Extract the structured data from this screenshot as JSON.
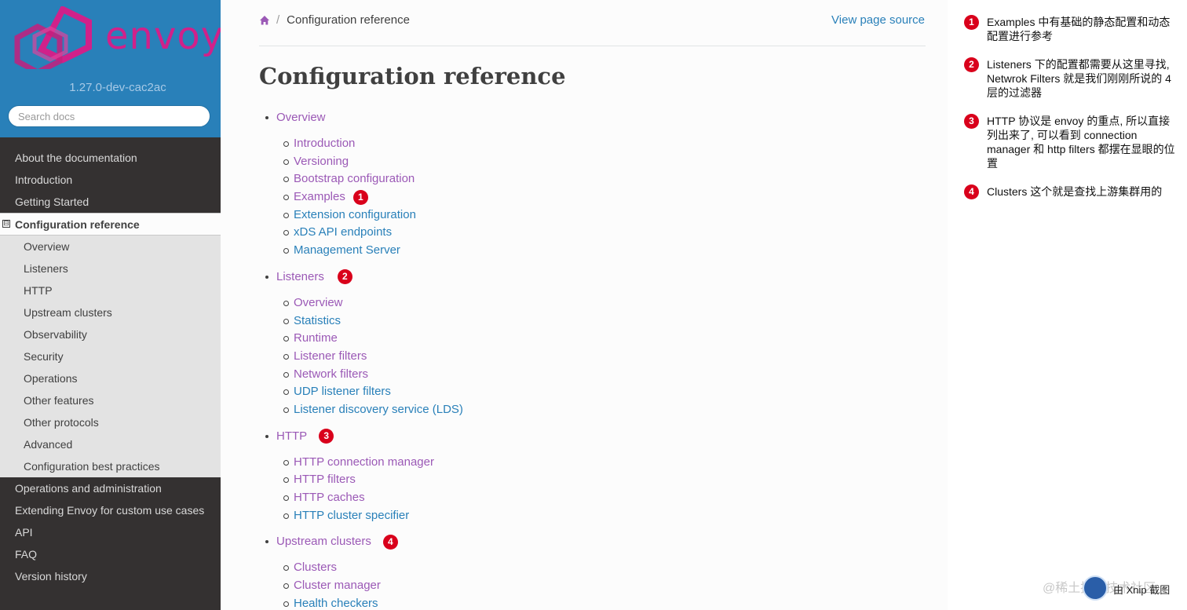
{
  "sidebar": {
    "logo_text": "envoy",
    "version": "1.27.0-dev-cac2ac",
    "search_placeholder": "Search docs",
    "items_top": [
      "About the documentation",
      "Introduction",
      "Getting Started"
    ],
    "current": {
      "toggle": "⊟",
      "label": "Configuration reference"
    },
    "sub_items": [
      "Overview",
      "Listeners",
      "HTTP",
      "Upstream clusters",
      "Observability",
      "Security",
      "Operations",
      "Other features",
      "Other protocols",
      "Advanced",
      "Configuration best practices"
    ],
    "items_bottom": [
      "Operations and administration",
      "Extending Envoy for custom use cases",
      "API",
      "FAQ",
      "Version history"
    ]
  },
  "colors": {
    "sidebar_bg": "#343131",
    "brand_bg": "#2980b9",
    "link": "#2980b9",
    "visited": "#9b59b6",
    "badge": "#d9001b"
  },
  "breadcrumb": {
    "home_icon": "home-icon",
    "separator": "/",
    "current": "Configuration reference"
  },
  "view_source": "View page source",
  "page_title": "Configuration reference",
  "toc": [
    {
      "label": "Overview",
      "badge": "",
      "links": [
        {
          "label": "Introduction",
          "visited": true
        },
        {
          "label": "Versioning",
          "visited": true
        },
        {
          "label": "Bootstrap configuration",
          "visited": true
        },
        {
          "label": "Examples",
          "visited": true,
          "badge": "1"
        },
        {
          "label": "Extension configuration",
          "visited": false
        },
        {
          "label": "xDS API endpoints",
          "visited": false
        },
        {
          "label": "Management Server",
          "visited": false
        }
      ]
    },
    {
      "label": "Listeners",
      "badge": "2",
      "links": [
        {
          "label": "Overview",
          "visited": true
        },
        {
          "label": "Statistics",
          "visited": false
        },
        {
          "label": "Runtime",
          "visited": true
        },
        {
          "label": "Listener filters",
          "visited": true
        },
        {
          "label": "Network filters",
          "visited": true
        },
        {
          "label": "UDP listener filters",
          "visited": false
        },
        {
          "label": "Listener discovery service (LDS)",
          "visited": false
        }
      ]
    },
    {
      "label": "HTTP",
      "badge": "3",
      "links": [
        {
          "label": "HTTP connection manager",
          "visited": true
        },
        {
          "label": "HTTP filters",
          "visited": true
        },
        {
          "label": "HTTP caches",
          "visited": true
        },
        {
          "label": "HTTP cluster specifier",
          "visited": false
        }
      ]
    },
    {
      "label": "Upstream clusters",
      "badge": "4",
      "links": [
        {
          "label": "Clusters",
          "visited": true
        },
        {
          "label": "Cluster manager",
          "visited": true
        },
        {
          "label": "Health checkers",
          "visited": false
        }
      ]
    }
  ],
  "notes": [
    {
      "num": "1",
      "text": "Examples 中有基础的静态配置和动态配置进行参考"
    },
    {
      "num": "2",
      "text": "Listeners 下的配置都需要从这里寻找, Netwrok Filters 就是我们刚刚所说的 4 层的过滤器"
    },
    {
      "num": "3",
      "text": "HTTP 协议是 envoy 的重点, 所以直接列出来了, 可以看到 connection manager 和 http filters 都摆在显眼的位置"
    },
    {
      "num": "4",
      "text": "Clusters 这个就是查找上游集群用的"
    }
  ],
  "watermark": "@稀土掘金技术社区",
  "xnip": "由 Xnip 截图"
}
